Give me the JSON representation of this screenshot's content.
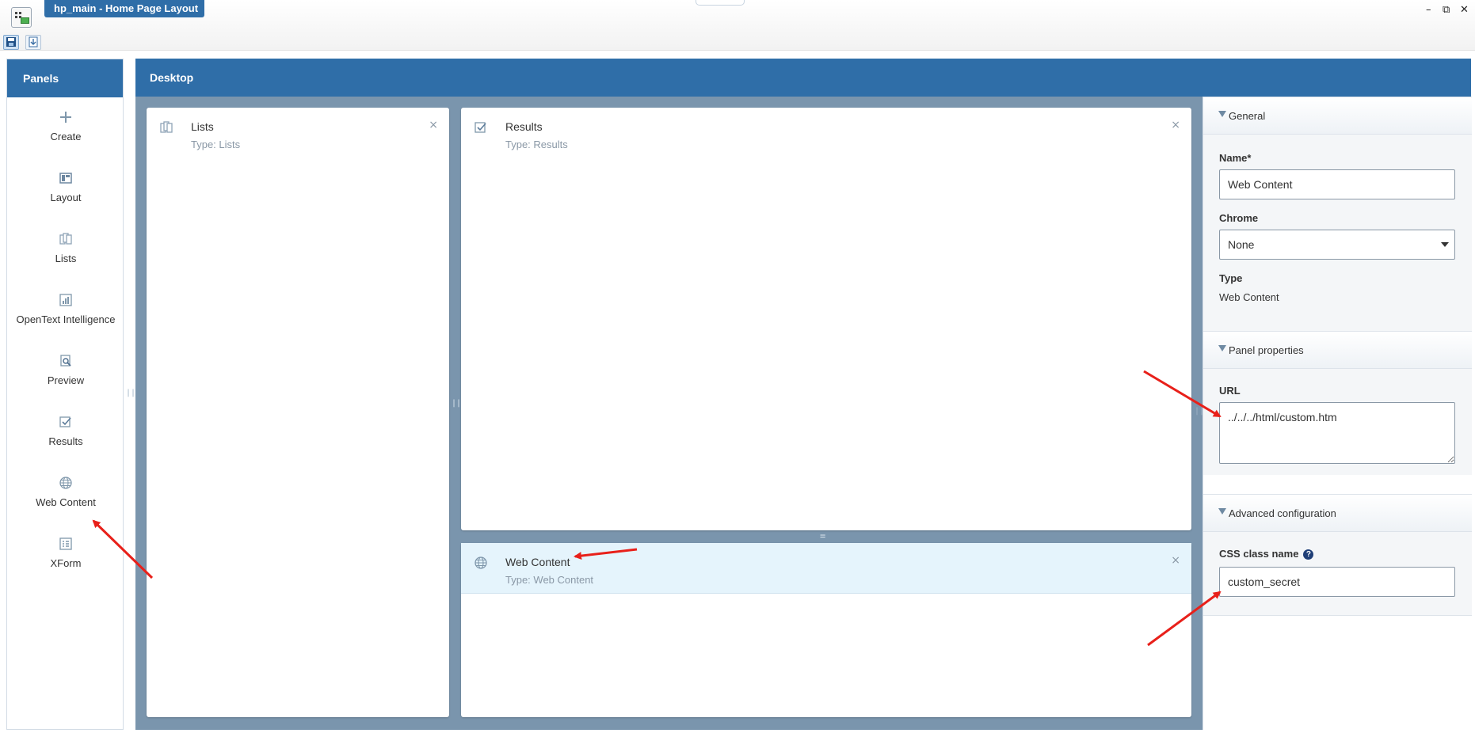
{
  "window": {
    "title": "hp_main - Home Page Layout",
    "controls": {
      "minimize": "–",
      "restore": "⧉",
      "close": "✕"
    }
  },
  "toolbar": {
    "icons": [
      "save-icon",
      "export-icon"
    ]
  },
  "panels": {
    "header": "Panels",
    "items": [
      {
        "label": "Create",
        "icon": "plus-icon"
      },
      {
        "label": "Layout",
        "icon": "layout-icon"
      },
      {
        "label": "Lists",
        "icon": "lists-icon"
      },
      {
        "label": "OpenText Intelligence",
        "icon": "chart-icon"
      },
      {
        "label": "Preview",
        "icon": "preview-icon"
      },
      {
        "label": "Results",
        "icon": "results-icon"
      },
      {
        "label": "Web Content",
        "icon": "globe-icon"
      },
      {
        "label": "XForm",
        "icon": "xform-icon"
      }
    ]
  },
  "desktop": {
    "header": "Desktop",
    "cards": [
      {
        "title": "Lists",
        "type": "Type: Lists"
      },
      {
        "title": "Results",
        "type": "Type: Results"
      },
      {
        "title": "Web Content",
        "type": "Type: Web Content"
      }
    ],
    "close_glyph": "×"
  },
  "properties": {
    "general": {
      "header": "General",
      "name_label": "Name*",
      "name_value": "Web Content",
      "chrome_label": "Chrome",
      "chrome_value": "None",
      "type_label": "Type",
      "type_value": "Web Content"
    },
    "panel_properties": {
      "header": "Panel properties",
      "url_label": "URL",
      "url_value": "../../../html/custom.htm",
      "code_glyph": "</>"
    },
    "advanced": {
      "header": "Advanced configuration",
      "css_label": "CSS class name",
      "help_glyph": "?",
      "css_value": "custom_secret"
    }
  },
  "colors": {
    "header_blue": "#2f6ea8",
    "desktop_bg": "#7a95ad",
    "selected_card": "#e5f4fc",
    "annotation_arrow": "#e8201a"
  }
}
